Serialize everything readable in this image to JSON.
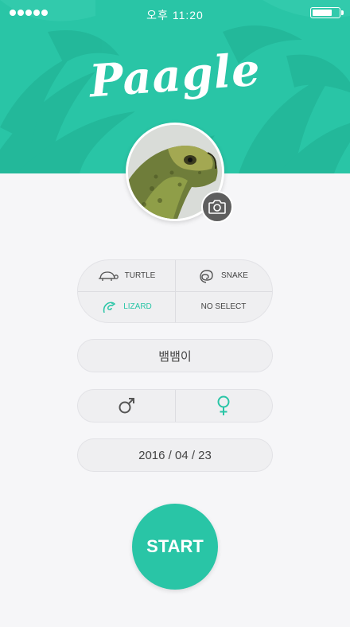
{
  "status_bar": {
    "time": "오후 11:20"
  },
  "app": {
    "logo": "Paagle"
  },
  "species": {
    "options": [
      {
        "label": "TURTLE",
        "icon": "turtle-icon",
        "selected": false
      },
      {
        "label": "SNAKE",
        "icon": "snake-icon",
        "selected": false
      },
      {
        "label": "LIZARD",
        "icon": "lizard-icon",
        "selected": true
      },
      {
        "label": "NO SELECT",
        "icon": "",
        "selected": false
      }
    ]
  },
  "pet_name": "뱀뱀이",
  "gender": {
    "male_icon": "male-icon",
    "female_icon": "female-icon",
    "selected": "female"
  },
  "birth_date": "2016 / 04 / 23",
  "start_button": "START",
  "colors": {
    "accent": "#29c5a6",
    "background": "#f6f6f8",
    "camera_button": "#5e5e5e"
  }
}
